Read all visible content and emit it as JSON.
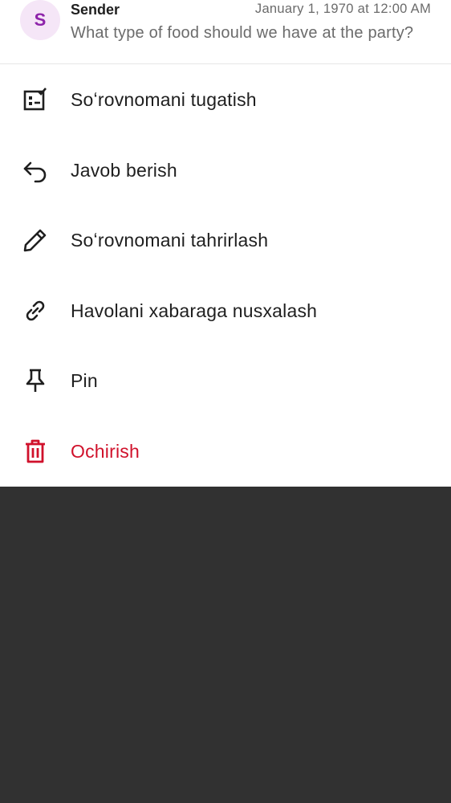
{
  "header": {
    "avatar_initial": "S",
    "sender": "Sender",
    "timestamp": "January 1, 1970 at 12:00 AM",
    "preview": "What type of food should we have at the party?"
  },
  "menu": {
    "items": [
      {
        "label": "Soʻrovnomani tugatish",
        "icon": "end-poll-icon"
      },
      {
        "label": "Javob berish",
        "icon": "reply-icon"
      },
      {
        "label": "Soʻrovnomani tahrirlash",
        "icon": "edit-pencil-icon"
      },
      {
        "label": "Havolani xabaraga nusxalash",
        "icon": "link-icon"
      },
      {
        "label": "Pin",
        "icon": "pin-icon"
      },
      {
        "label": "Ochirish",
        "icon": "trash-icon"
      }
    ]
  },
  "colors": {
    "danger": "#d0112b",
    "avatar_bg": "#f5e6f7",
    "avatar_fg": "#8e24aa",
    "backdrop": "#313131"
  }
}
